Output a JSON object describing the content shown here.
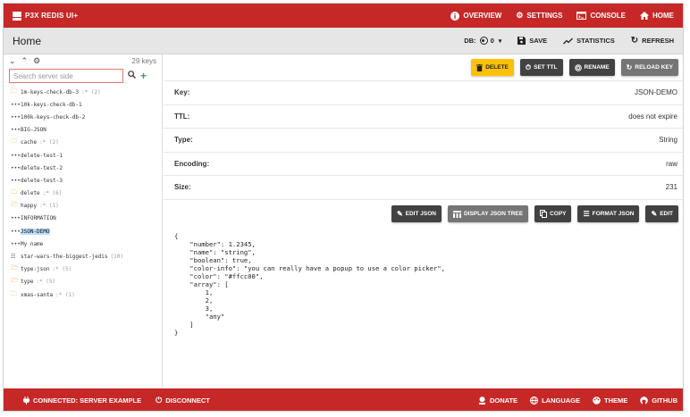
{
  "app": {
    "title": "P3X REDIS UI+"
  },
  "topnav": {
    "overview": "OVERVIEW",
    "settings": "SETTINGS",
    "console": "CONSOLE",
    "home": "HOME"
  },
  "titlebar": {
    "title": "Home",
    "db_label": "DB:",
    "db_value": "0",
    "save": "SAVE",
    "statistics": "STATISTICS",
    "refresh": "REFRESH"
  },
  "sidebar": {
    "key_count": "29 keys",
    "search_placeholder": "Search server side",
    "items": [
      {
        "label": "1m-keys-check-db-3",
        "count": ":* (2)",
        "type": "folder"
      },
      {
        "label": "10k-keys-check-db-1",
        "count": "",
        "type": "key"
      },
      {
        "label": "100k-keys-check-db-2",
        "count": "",
        "type": "key"
      },
      {
        "label": "BIG-JSON",
        "count": "",
        "type": "key"
      },
      {
        "label": "cache",
        "count": ":* (2)",
        "type": "folder"
      },
      {
        "label": "delete-test-1",
        "count": "",
        "type": "key"
      },
      {
        "label": "delete-test-2",
        "count": "",
        "type": "key"
      },
      {
        "label": "delete-test-3",
        "count": "",
        "type": "key"
      },
      {
        "label": "delete",
        "count": ":* (6)",
        "type": "folder"
      },
      {
        "label": "happy",
        "count": ":* (1)",
        "type": "folder-open"
      },
      {
        "label": "INFORMATION",
        "count": "",
        "type": "key"
      },
      {
        "label": "JSON-DEMO",
        "count": "",
        "type": "key",
        "selected": true
      },
      {
        "label": "My name",
        "count": "",
        "type": "key"
      },
      {
        "label": "star-wars-the-biggest-jedis",
        "count": "(10)",
        "type": "list"
      },
      {
        "label": "type:json",
        "count": ":* (5)",
        "type": "folder-open"
      },
      {
        "label": "type",
        "count": ":* (5)",
        "type": "folder-open"
      },
      {
        "label": "xmas-santa",
        "count": ":* (1)",
        "type": "folder"
      }
    ]
  },
  "key_actions": {
    "delete": "DELETE",
    "set_ttl": "SET TTL",
    "rename": "RENAME",
    "reload_key": "RELOAD KEY"
  },
  "key_info": [
    {
      "label": "Key:",
      "value": "JSON-DEMO"
    },
    {
      "label": "TTL:",
      "value": "does not expire"
    },
    {
      "label": "Type:",
      "value": "String"
    },
    {
      "label": "Encoding:",
      "value": "raw"
    },
    {
      "label": "Size:",
      "value": "231"
    }
  ],
  "json_actions": {
    "edit_json": "EDIT JSON",
    "display_tree": "DISPLAY JSON TREE",
    "copy": "COPY",
    "format_json": "FORMAT JSON",
    "edit": "EDIT"
  },
  "json_content": "{\n    \"number\": 1.2345,\n    \"name\": \"string\",\n    \"boolean\": true,\n    \"color-info\": \"you can really have a popup to use a color picker\",\n    \"color\": \"#ffcc00\",\n    \"array\": [\n        1,\n        2,\n        3,\n        \"any\"\n    ]\n}",
  "bottombar": {
    "connected": "CONNECTED: SERVER EXAMPLE",
    "disconnect": "DISCONNECT",
    "donate": "DONATE",
    "language": "LANGUAGE",
    "theme": "THEME",
    "github": "GITHUB"
  },
  "colors": {
    "primary": "#c62828",
    "accent_yellow": "#ffc107",
    "selection": "#bbdefb",
    "add_green": "#43a047"
  }
}
